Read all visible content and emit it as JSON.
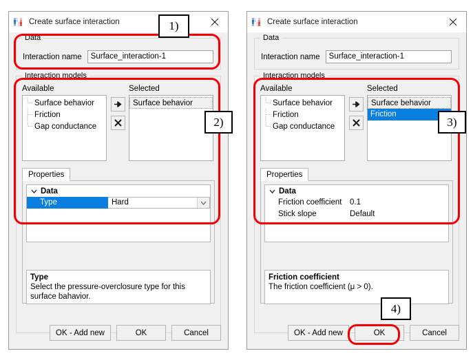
{
  "dialogs": [
    {
      "title": "Create surface interaction",
      "icon": "abaqus-mesh-icon",
      "close_icon": "close-icon",
      "data_group": {
        "legend": "Data",
        "name_label": "Interaction name",
        "name_value": "Surface_interaction-1",
        "name_placeholder": "Interaction name"
      },
      "models_group": {
        "legend": "Interaction models",
        "available_label": "Available",
        "selected_label": "Selected",
        "available_items": [
          "Surface behavior",
          "Friction",
          "Gap conductance"
        ],
        "selected_items": [
          {
            "label": "Surface behavior",
            "state": "focused"
          }
        ],
        "add_button_icon": "arrow-right-icon",
        "remove_button_icon": "close-x-icon"
      },
      "tabs": [
        {
          "label": "Properties",
          "active": true
        }
      ],
      "property_grid": {
        "category": "Data",
        "category_expander_icon": "chevron-down-icon",
        "rows": [
          {
            "name": "Type",
            "value": "Hard",
            "highlighted": true,
            "editor": "combobox",
            "editor_icon": "chevron-down-icon"
          }
        ]
      },
      "description": {
        "title": "Type",
        "text": "Select the pressure-overclosure type for this surface bahavior."
      },
      "buttons": [
        {
          "label": "OK - Add new",
          "highlighted": false
        },
        {
          "label": "OK",
          "highlighted": false
        },
        {
          "label": "Cancel",
          "highlighted": false
        }
      ]
    },
    {
      "title": "Create surface interaction",
      "icon": "abaqus-mesh-icon",
      "close_icon": "close-icon",
      "data_group": {
        "legend": "Data",
        "name_label": "Interaction name",
        "name_value": "Surface_interaction-1",
        "name_placeholder": "Interaction name"
      },
      "models_group": {
        "legend": "Interaction models",
        "available_label": "Available",
        "selected_label": "Selected",
        "available_items": [
          "Surface behavior",
          "Friction",
          "Gap conductance"
        ],
        "selected_items": [
          {
            "label": "Surface behavior",
            "state": "normal"
          },
          {
            "label": "Friction",
            "state": "highlighted"
          }
        ],
        "add_button_icon": "arrow-right-icon",
        "remove_button_icon": "close-x-icon"
      },
      "tabs": [
        {
          "label": "Properties",
          "active": true
        }
      ],
      "property_grid": {
        "category": "Data",
        "category_expander_icon": "chevron-down-icon",
        "rows": [
          {
            "name": "Friction coefficient",
            "value": "0.1",
            "highlighted": false,
            "editor": "text"
          },
          {
            "name": "Stick slope",
            "value": "Default",
            "highlighted": false,
            "editor": "text"
          }
        ]
      },
      "description": {
        "title": "Friction coefficient",
        "text": "The friction coefficient (μ > 0)."
      },
      "buttons": [
        {
          "label": "OK - Add new",
          "highlighted": false
        },
        {
          "label": "OK",
          "highlighted": true
        },
        {
          "label": "Cancel",
          "highlighted": false
        }
      ]
    }
  ],
  "annotations": [
    {
      "label": "1)",
      "color": "#f50000"
    },
    {
      "label": "2)",
      "color": "#f50000"
    },
    {
      "label": "3)",
      "color": "#f50000"
    },
    {
      "label": "4)",
      "color": "#f50000"
    }
  ],
  "colors": {
    "annotation_red": "#f50000",
    "selection_blue": "#0a7fe0",
    "dialog_bg": "#f0f0f0",
    "titlebar_bg": "#ffffff"
  }
}
